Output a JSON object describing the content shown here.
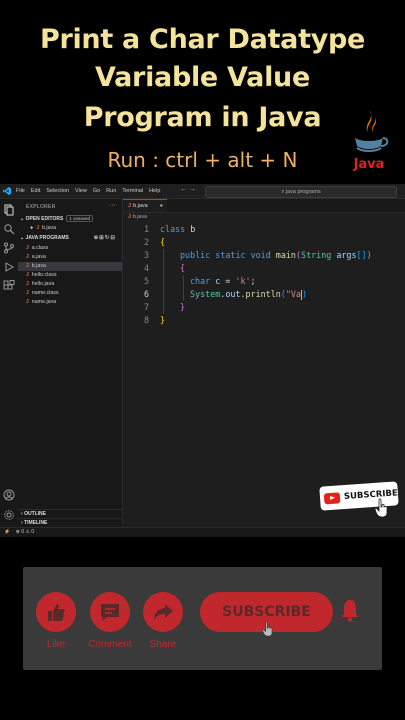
{
  "banner": {
    "title_line1": "Print a Char  Datatype",
    "title_line2": "Variable Value",
    "title_line3": "Program in Java",
    "run_hint": "Run : ctrl + alt + N",
    "java_logo_text": "Java"
  },
  "vscode": {
    "menu": [
      "File",
      "Edit",
      "Selection",
      "View",
      "Go",
      "Run",
      "Terminal",
      "Help"
    ],
    "nav_arrows": "←  →",
    "search_text": "java programs",
    "explorer_title": "EXPLORER",
    "explorer_more": "···",
    "open_editors_label": "OPEN EDITORS",
    "open_editors_badge": "1 unsaved",
    "open_editor_file": "b.java",
    "project_label": "JAVA PROGRAMS",
    "files": [
      "a.class",
      "a.java",
      "b.java",
      "hello.class",
      "hello.java",
      "name.class",
      "name.java"
    ],
    "file_icon_letter": "J",
    "outline_label": "OUTLINE",
    "timeline_label": "TIMELINE",
    "tab_label": "b.java",
    "breadcrumb": "b.java",
    "status_text": "⊗ 0 ⚠ 0",
    "code_lines": [
      {
        "n": "1"
      },
      {
        "n": "2"
      },
      {
        "n": "3"
      },
      {
        "n": "4"
      },
      {
        "n": "5"
      },
      {
        "n": "6"
      },
      {
        "n": "7"
      },
      {
        "n": "8"
      }
    ],
    "code": {
      "l1_kw": "class",
      "l1_name": " b",
      "l2": "{",
      "l3_kw": "public static void",
      "l3_fn": " main",
      "l3_open": "(",
      "l3_type": "String",
      "l3_arg": " args",
      "l3_arr": "[]",
      "l3_close": ")",
      "l4": "{",
      "l5_kw": "char",
      "l5_var": " c",
      "l5_eq": " = ",
      "l5_str": "'k'",
      "l5_semi": ";",
      "l6_cls": "System",
      "l6_dot1": ".",
      "l6_field": "out",
      "l6_dot2": ".",
      "l6_fn": "println",
      "l6_open": "(",
      "l6_str": "\"Va",
      "l6_close": ")",
      "l7": "}",
      "l8": "}"
    },
    "colors": {
      "editor_bg": "#1e1e1e",
      "sidebar_bg": "#181818",
      "accent": "#0078d4",
      "java_icon": "#e06c50"
    }
  },
  "subscribe_badge": {
    "label": "SUBSCRIBE"
  },
  "bottom_panel": {
    "like_label": "Like",
    "comment_label": "Comment",
    "share_label": "Share",
    "subscribe_label": "SUBSCRIBE",
    "accent": "#c0282d"
  }
}
